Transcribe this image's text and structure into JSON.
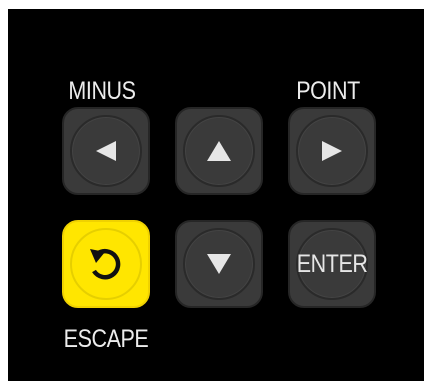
{
  "labels": {
    "minus": "MINUS",
    "point": "POINT",
    "escape": "ESCAPE"
  },
  "keys": {
    "left": {
      "icon": "triangle-left-icon"
    },
    "up": {
      "icon": "triangle-up-icon"
    },
    "right": {
      "icon": "triangle-right-icon"
    },
    "escape": {
      "icon": "rotate-icon"
    },
    "down": {
      "icon": "triangle-down-icon"
    },
    "enter": {
      "label": "ENTER"
    }
  },
  "colors": {
    "panel": "#000000",
    "key": "#3a3a3a",
    "escape_key": "#ffe600",
    "icon": "#e6e6e6",
    "label_text": "#ececec"
  }
}
